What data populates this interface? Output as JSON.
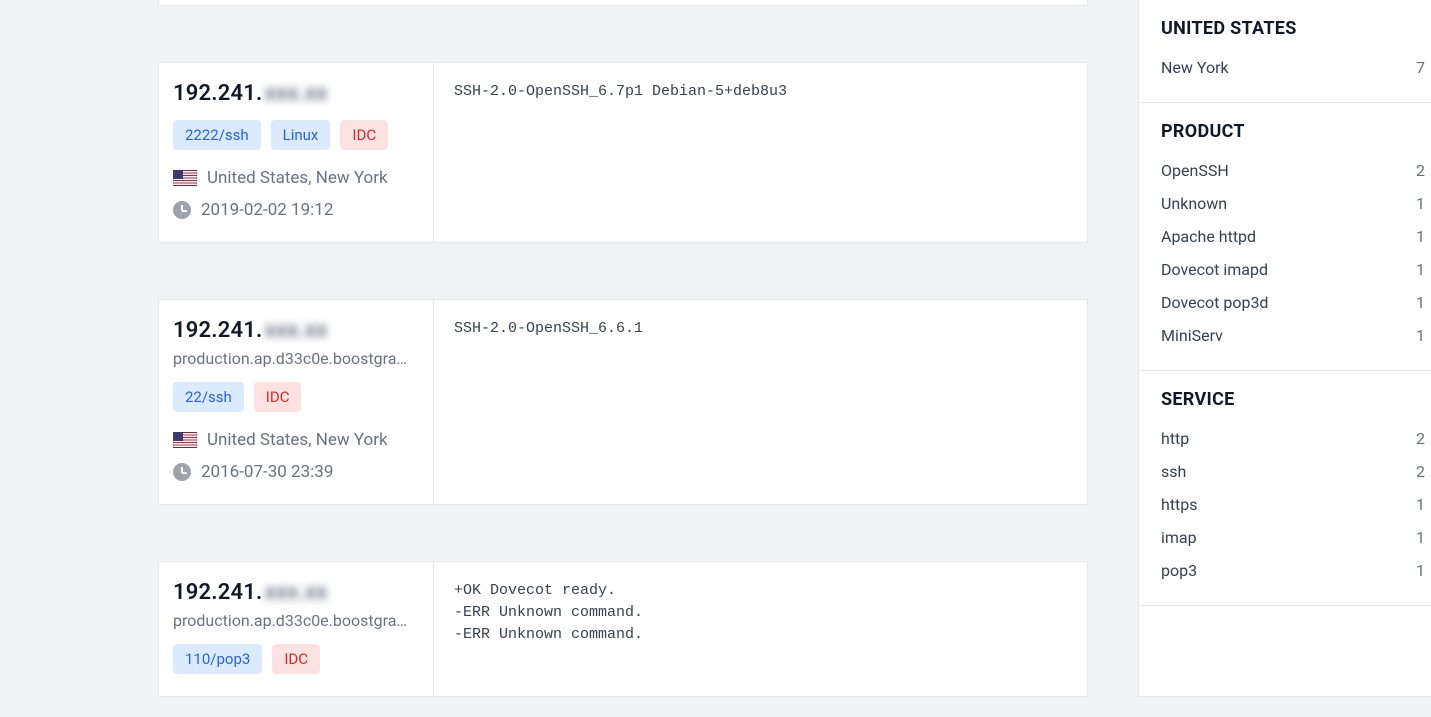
{
  "results": [
    {
      "ip_prefix": "192.241.",
      "ip_suffix": "xxx.xx",
      "hostname": "",
      "tags": [
        {
          "label": "2222/ssh",
          "variant": "blue"
        },
        {
          "label": "Linux",
          "variant": "blue"
        },
        {
          "label": "IDC",
          "variant": "red"
        }
      ],
      "location": "United States, New York",
      "timestamp": "2019-02-02 19:12",
      "banner": "SSH-2.0-OpenSSH_6.7p1 Debian-5+deb8u3"
    },
    {
      "ip_prefix": "192.241.",
      "ip_suffix": "xxx.xx",
      "hostname": "production.ap.d33c0e.boostgram…",
      "tags": [
        {
          "label": "22/ssh",
          "variant": "blue"
        },
        {
          "label": "IDC",
          "variant": "red"
        }
      ],
      "location": "United States, New York",
      "timestamp": "2016-07-30 23:39",
      "banner": "SSH-2.0-OpenSSH_6.6.1"
    },
    {
      "ip_prefix": "192.241.",
      "ip_suffix": "xxx.xx",
      "hostname": "production.ap.d33c0e.boostgram…",
      "tags": [
        {
          "label": "110/pop3",
          "variant": "blue"
        },
        {
          "label": "IDC",
          "variant": "red"
        }
      ],
      "location": "",
      "timestamp": "",
      "banner": "+OK Dovecot ready.\n-ERR Unknown command.\n-ERR Unknown command."
    }
  ],
  "facets": [
    {
      "title": "UNITED STATES",
      "rows": [
        {
          "label": "New York",
          "count": "7"
        }
      ]
    },
    {
      "title": "PRODUCT",
      "rows": [
        {
          "label": "OpenSSH",
          "count": "2"
        },
        {
          "label": "Unknown",
          "count": "1"
        },
        {
          "label": "Apache httpd",
          "count": "1"
        },
        {
          "label": "Dovecot imapd",
          "count": "1"
        },
        {
          "label": "Dovecot pop3d",
          "count": "1"
        },
        {
          "label": "MiniServ",
          "count": "1"
        }
      ]
    },
    {
      "title": "SERVICE",
      "rows": [
        {
          "label": "http",
          "count": "2"
        },
        {
          "label": "ssh",
          "count": "2"
        },
        {
          "label": "https",
          "count": "1"
        },
        {
          "label": "imap",
          "count": "1"
        },
        {
          "label": "pop3",
          "count": "1"
        }
      ]
    }
  ]
}
